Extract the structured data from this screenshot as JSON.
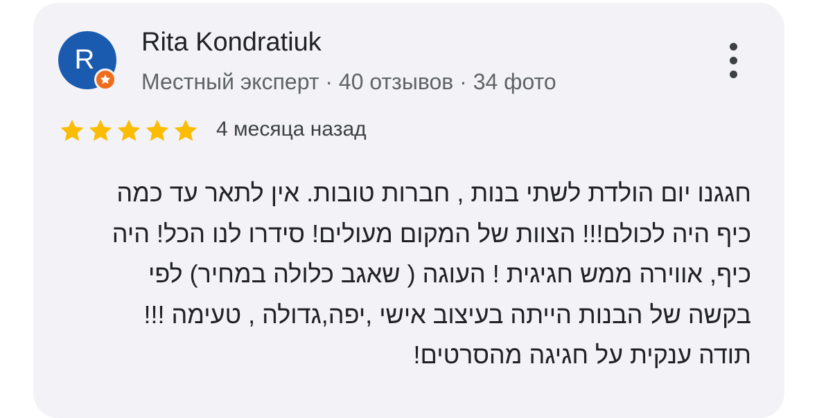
{
  "review": {
    "author": {
      "initial": "R",
      "name": "Rita Kondratiuk",
      "meta": "Местный эксперт · 40 отзывов · 34 фото"
    },
    "rating": 5,
    "date": "4 месяца назад",
    "text_lines": [
      "חגגנו יום הולדת לשתי בנות , חברות טובות. אין לתאר עד כמה",
      "כיף היה לכולם!!! הצוות של המקום מעולים! סידרו לנו הכל! היה",
      "כיף, אווירה ממש חגיגית ! העוגה ( שאגב כלולה במחיר) לפי",
      "בקשה של הבנות הייתה בעיצוב אישי ,יפה,גדולה , טעימה !!!",
      "תודה ענקית על חגיגה מהסרטים!"
    ]
  },
  "icons": {
    "badge": "local-guide-badge-icon",
    "more": "more-vert-icon",
    "star": "star-icon"
  },
  "colors": {
    "card_bg": "#f3f3f7",
    "avatar_bg": "#1a5bb0",
    "badge": "#ef6c1c",
    "star": "#fbbc04",
    "text": "#202124",
    "secondary_text": "#5f6368"
  }
}
